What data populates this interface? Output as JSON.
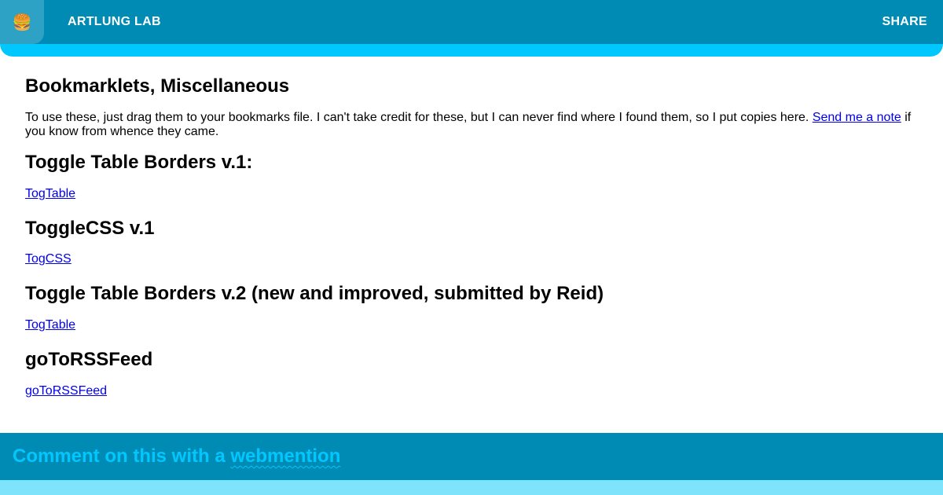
{
  "header": {
    "menu_icon": "🍔",
    "brand": "ARTLUNG LAB",
    "share": "SHARE"
  },
  "main": {
    "title": "Bookmarklets, Miscellaneous",
    "intro_text": "To use these, just drag them to your bookmarks file. I can't take credit for these, but I can never find where I found them, so I put copies here.",
    "intro_link": "Send me a note",
    "intro_tail": " if you know from whence they came.",
    "sections": [
      {
        "heading": "Toggle Table Borders v.1:",
        "link": "TogTable"
      },
      {
        "heading": "ToggleCSS v.1",
        "link": "TogCSS"
      },
      {
        "heading": "Toggle Table Borders v.2 (new and improved, submitted by Reid)",
        "link": "TogTable"
      },
      {
        "heading": "goToRSSFeed",
        "link": "goToRSSFeed"
      }
    ]
  },
  "footer": {
    "prefix": "Comment on this with a ",
    "link": "webmention"
  },
  "colors": {
    "header_bg": "#008bb5",
    "accent": "#00c8ff",
    "footer_strip": "#7fe3fb",
    "link": "#0000ee"
  }
}
